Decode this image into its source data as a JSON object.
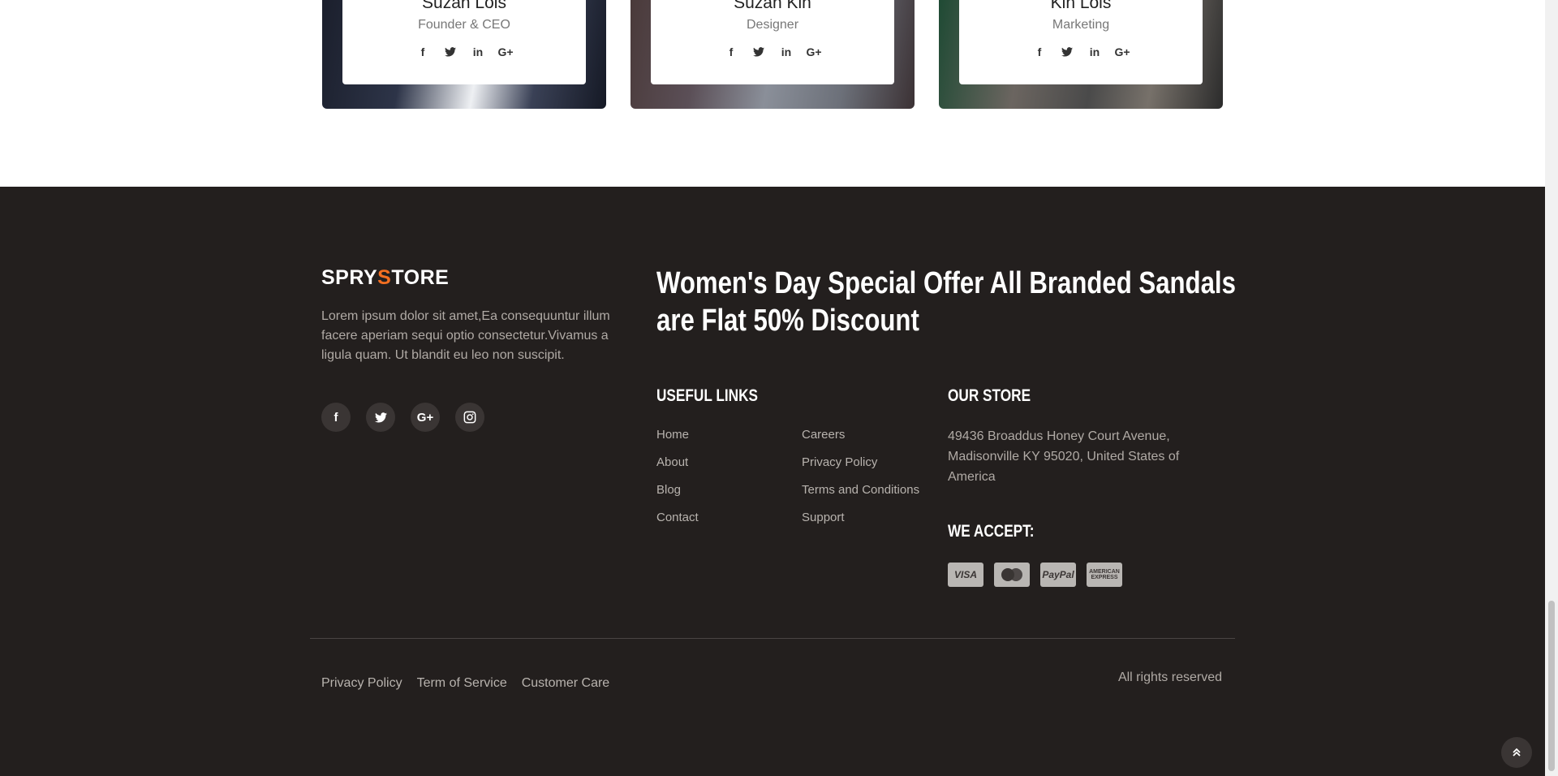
{
  "team": {
    "members": [
      {
        "name": "Suzan Lois",
        "role": "Founder & CEO"
      },
      {
        "name": "Suzan Kin",
        "role": "Designer"
      },
      {
        "name": "Kin Lois",
        "role": "Marketing"
      }
    ],
    "social_icons": {
      "facebook": "f",
      "twitter": "🐦",
      "linkedin": "in",
      "google_plus": "G+"
    }
  },
  "footer": {
    "logo": {
      "part1": "SPRY",
      "accent": "S",
      "part2": "TORE",
      "accent_color": "#f36f21"
    },
    "about": "Lorem ipsum dolor sit amet,Ea consequuntur illum facere aperiam sequi optio consectetur.Vivamus a ligula quam. Ut blandit eu leo non suscipit.",
    "social": {
      "facebook": "f",
      "twitter": "🐦",
      "google_plus": "G+",
      "instagram": "◎"
    },
    "promo": "Women's Day Special Offer All Branded Sandals are Flat 50% Discount",
    "useful_links": {
      "title": "USEFUL LINKS",
      "col1": [
        "Home",
        "About",
        "Blog",
        "Contact"
      ],
      "col2": [
        "Careers",
        "Privacy Policy",
        "Terms and Conditions",
        "Support"
      ]
    },
    "store": {
      "title": "OUR STORE",
      "address": "49436 Broaddus Honey Court Avenue, Madisonville KY 95020, United States of America"
    },
    "accept": {
      "title": "WE ACCEPT:",
      "cards": [
        "VISA",
        "mastercard",
        "PayPal",
        "AMERICAN EXPRESS"
      ]
    },
    "bottom_links": [
      "Privacy Policy",
      "Term of Service",
      "Customer Care"
    ],
    "rights": "All rights reserved",
    "to_top_icon": "»"
  },
  "colors": {
    "footer_bg": "#231f1e",
    "accent": "#f36f21"
  }
}
